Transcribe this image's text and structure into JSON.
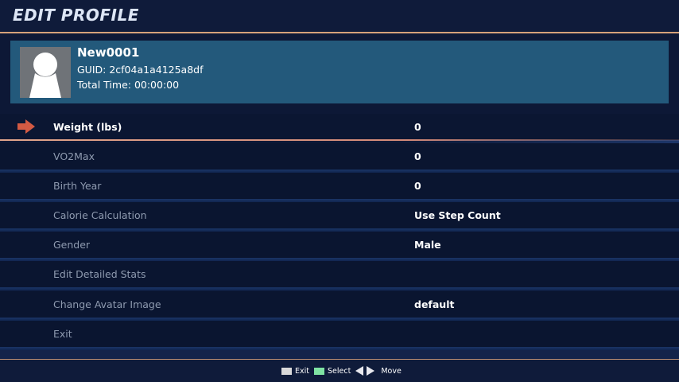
{
  "header": {
    "title": "EDIT PROFILE"
  },
  "profile": {
    "name": "New0001",
    "guid": "GUID: 2cf04a1a4125a8df",
    "total_time": "Total Time: 00:00:00"
  },
  "menu": {
    "selected_index": 0,
    "items": [
      {
        "label": "Weight (lbs)",
        "value": "0"
      },
      {
        "label": "VO2Max",
        "value": "0"
      },
      {
        "label": "Birth Year",
        "value": "0"
      },
      {
        "label": "Calorie Calculation",
        "value": "Use Step Count"
      },
      {
        "label": "Gender",
        "value": "Male"
      },
      {
        "label": "Edit Detailed Stats",
        "value": ""
      },
      {
        "label": "Change Avatar Image",
        "value": "default"
      },
      {
        "label": "Exit",
        "value": ""
      }
    ]
  },
  "footer": {
    "exit_label": "Exit",
    "select_label": "Select",
    "move_label": "Move"
  },
  "colors": {
    "accent": "#d6a27a",
    "arrow": "#d35a43",
    "profile_card": "#23597b",
    "select_key": "#7fe3a3",
    "exit_key": "#d9d9d9"
  }
}
